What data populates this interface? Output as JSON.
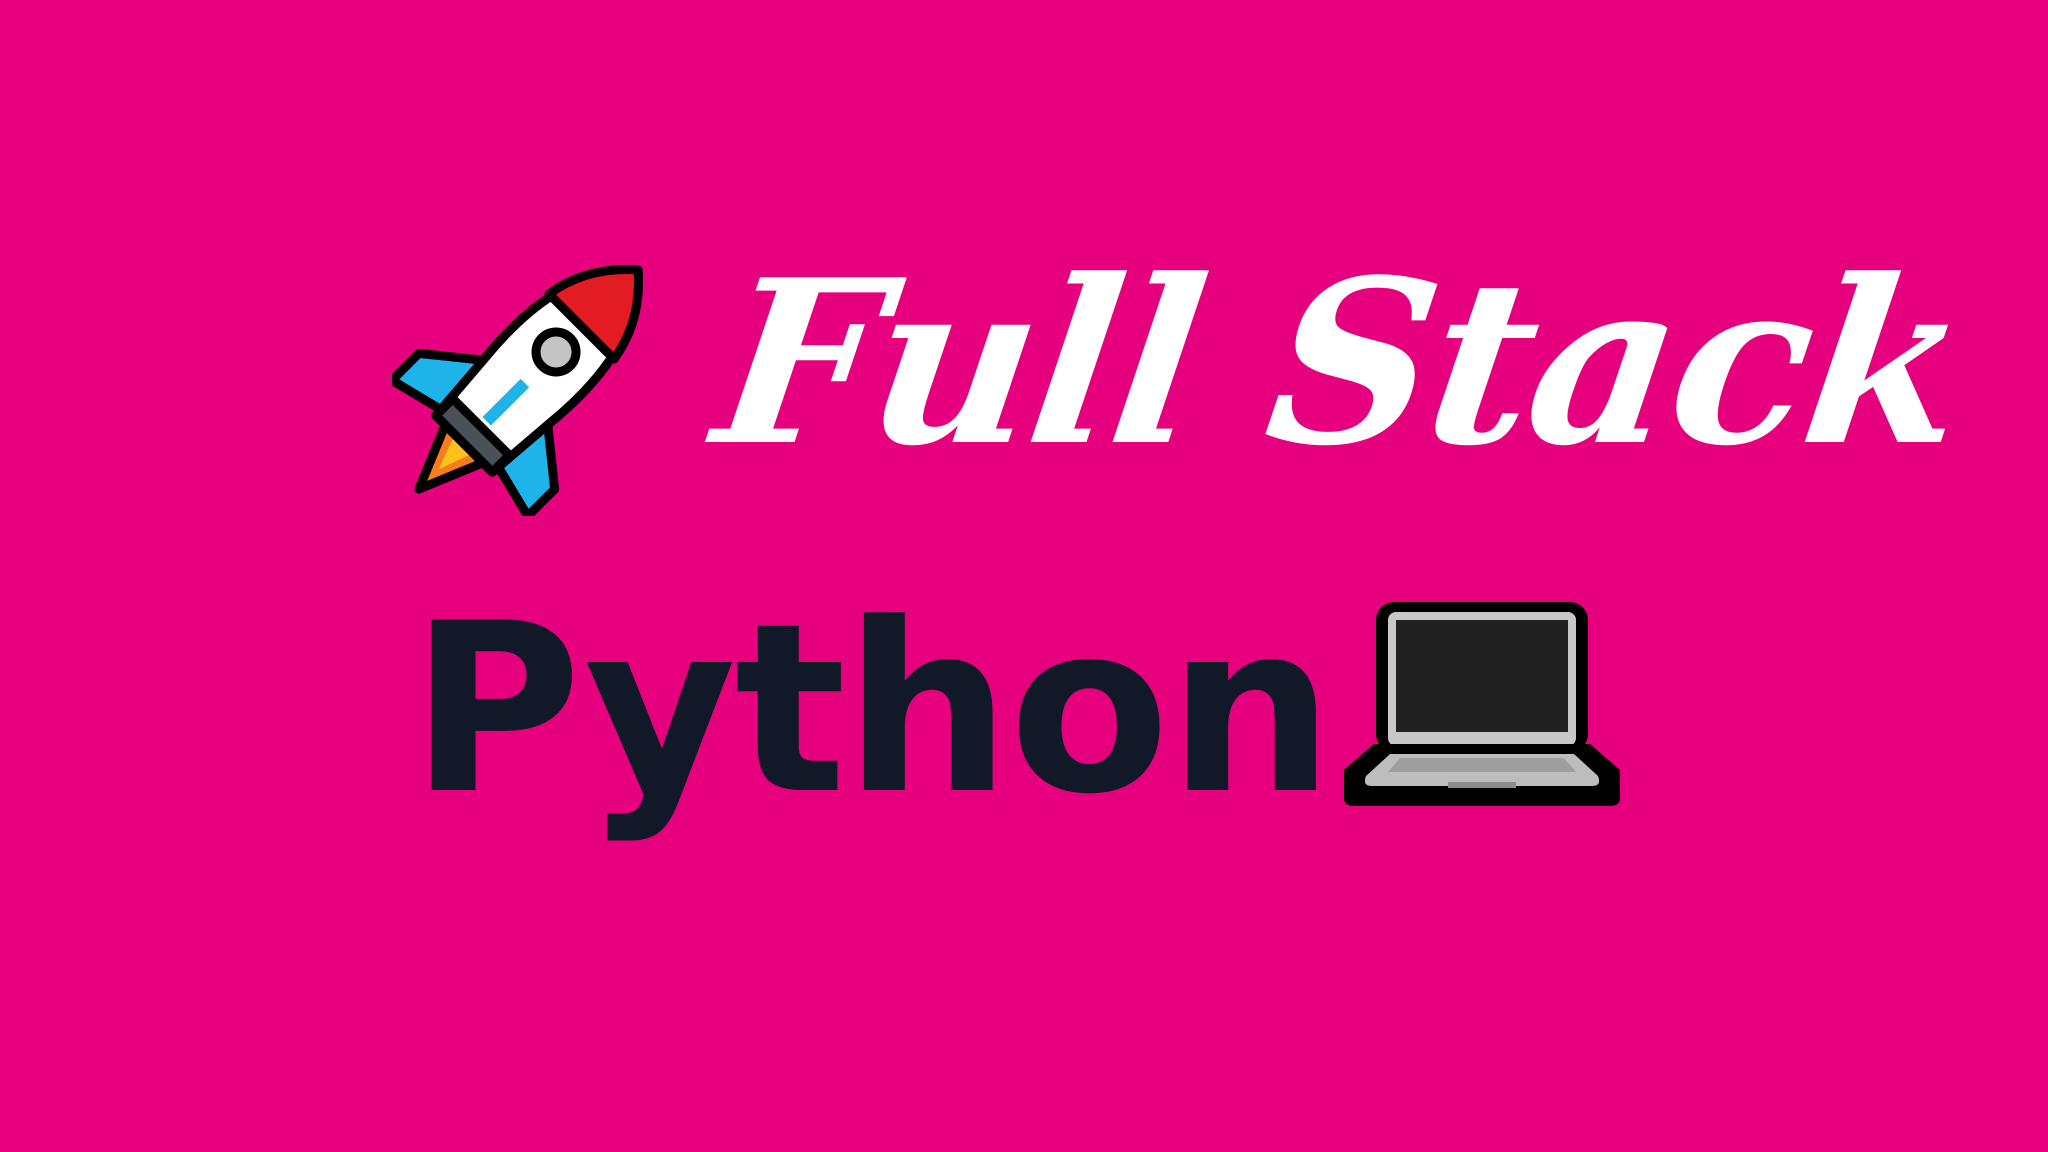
{
  "banner": {
    "title_script": "Full Stack",
    "title_main": "Python",
    "background_color": "#E6007E",
    "script_color": "#FFFFFF",
    "main_color": "#111827",
    "left_icon": "rocket-icon",
    "right_icon": "laptop-icon"
  }
}
